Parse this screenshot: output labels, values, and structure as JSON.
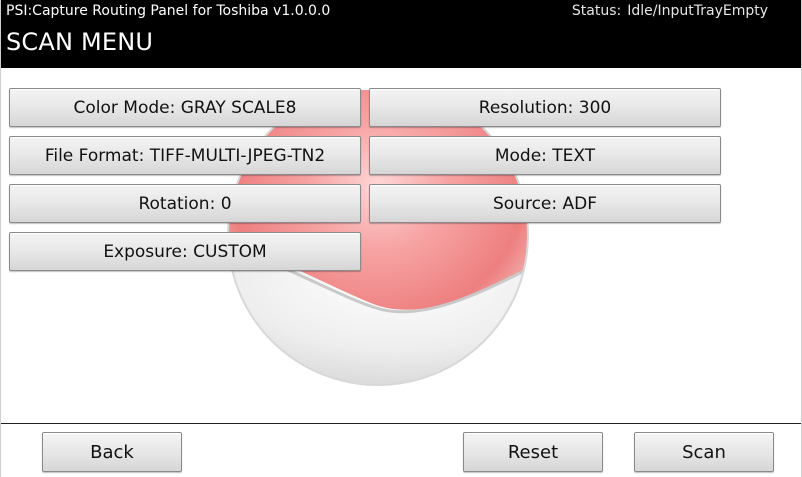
{
  "header": {
    "app_title": "PSI:Capture Routing Panel for Toshiba v1.0.0.0",
    "status_label": "Status:",
    "status_value": "Idle/InputTrayEmpty",
    "menu_title": "SCAN MENU"
  },
  "options": {
    "color_mode": "Color Mode: GRAY SCALE8",
    "resolution": "Resolution: 300",
    "file_format": "File Format: TIFF-MULTI-JPEG-TN2",
    "mode": "Mode: TEXT",
    "rotation": "Rotation: 0",
    "source": "Source: ADF",
    "exposure": "Exposure: CUSTOM"
  },
  "actions": {
    "back": "Back",
    "reset": "Reset",
    "scan": "Scan"
  },
  "colors": {
    "header_bg": "#000000",
    "accent_ball": "#e23a3a"
  },
  "background_icon": "red-sphere-watermark"
}
